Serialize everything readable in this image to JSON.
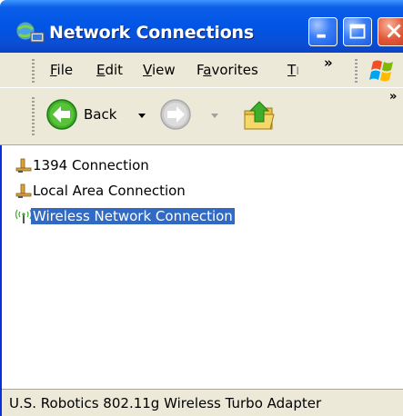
{
  "window": {
    "title": "Network Connections",
    "icon": "network-connections-icon"
  },
  "menu": {
    "items": [
      "File",
      "Edit",
      "View",
      "Favorites",
      "T"
    ],
    "mnemonics": [
      "F",
      "E",
      "V",
      "a",
      "T"
    ],
    "overflow": "»"
  },
  "toolbar": {
    "back_label": "Back",
    "overflow": "»"
  },
  "connections": [
    {
      "label": "1394 Connection",
      "icon": "wired-connection-icon",
      "selected": false
    },
    {
      "label": "Local Area Connection",
      "icon": "wired-connection-icon",
      "selected": false
    },
    {
      "label": "Wireless Network Connection",
      "icon": "wireless-connection-icon",
      "selected": true
    }
  ],
  "status": {
    "text": "U.S. Robotics 802.11g Wireless Turbo Adapter"
  },
  "colors": {
    "title_bar": "#0055e5",
    "selection": "#316ac5",
    "chrome": "#ece9d8",
    "close_button": "#e2593a"
  }
}
